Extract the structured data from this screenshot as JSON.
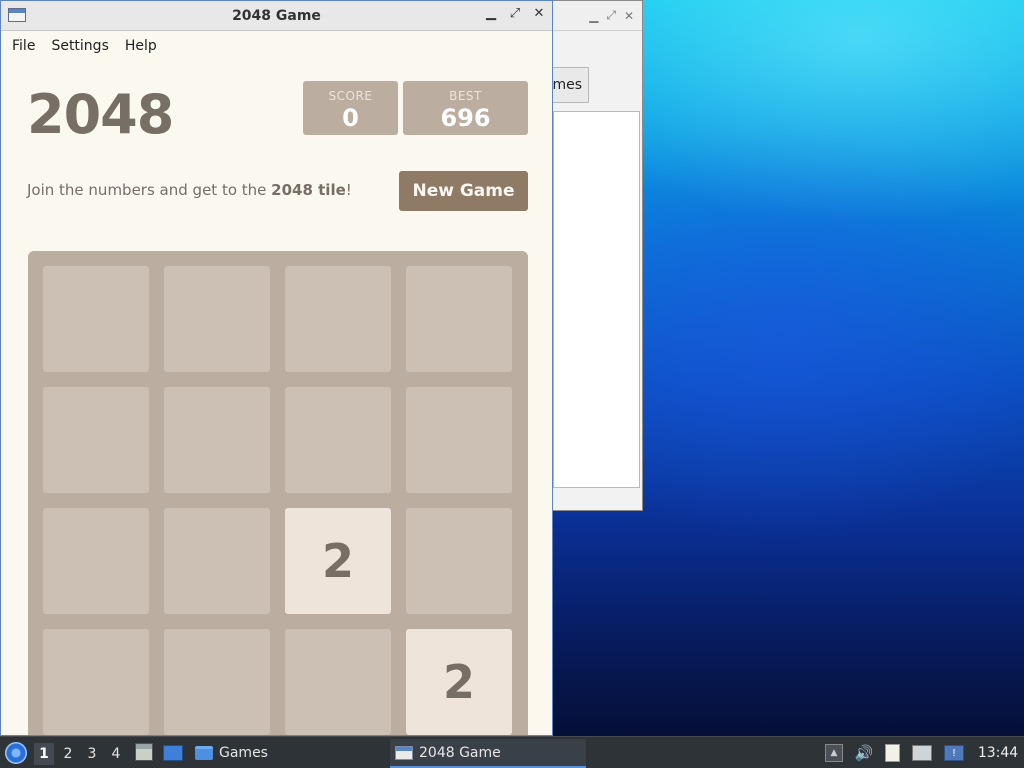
{
  "background_window": {
    "tab_label": "mes"
  },
  "window": {
    "title": "2048 Game",
    "controls": {
      "minimize": "▁",
      "maximize": "⤢",
      "close": "✕"
    }
  },
  "menu": {
    "file": "File",
    "settings": "Settings",
    "help": "Help"
  },
  "game": {
    "title": "2048",
    "score_label": "SCORE",
    "score_value": "0",
    "best_label": "BEST",
    "best_value": "696",
    "intro_text": "Join the numbers and get to the ",
    "intro_bold": "2048 tile",
    "intro_end": "!",
    "new_game_label": "New Game",
    "grid": [
      [
        "",
        "",
        "",
        ""
      ],
      [
        "",
        "",
        "",
        ""
      ],
      [
        "",
        "",
        "2",
        ""
      ],
      [
        "",
        "",
        "",
        "2"
      ]
    ]
  },
  "taskbar": {
    "workspaces": [
      "1",
      "2",
      "3",
      "4"
    ],
    "active_workspace": "1",
    "games_label": "Games",
    "app_label": "2048 Game",
    "clock": "13:44"
  },
  "colors": {
    "board": "#bbada0",
    "tile_2": "#eee4da",
    "text": "#776e65",
    "button": "#8f7a66",
    "page": "#faf8ef"
  }
}
